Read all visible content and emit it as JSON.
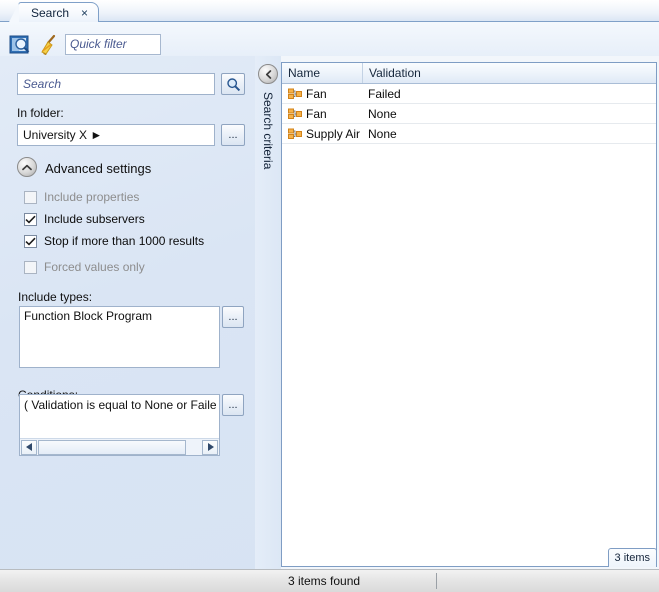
{
  "window": {
    "tab": {
      "label": "Search",
      "close_glyph": "×"
    }
  },
  "toolbar": {
    "search_icon_name": "search-document-icon",
    "clear_icon_name": "broom-clear-filter-icon",
    "quick_filter_placeholder": "Quick filter"
  },
  "criteria": {
    "search_placeholder": "Search",
    "search_button_icon": "magnifier-icon",
    "in_folder_label": "In folder:",
    "in_folder_value": "University X ►",
    "in_folder_browse_label": "...",
    "advanced_settings_label": "Advanced settings",
    "advanced_toggle_icon": "chevron-up-icon",
    "checkboxes": [
      {
        "label": "Include properties",
        "checked": false,
        "enabled": false
      },
      {
        "label": "Include subservers",
        "checked": true,
        "enabled": true
      },
      {
        "label": "Stop if more than 1000 results",
        "checked": true,
        "enabled": true
      },
      {
        "label": "Forced values only",
        "checked": false,
        "enabled": false
      }
    ],
    "include_types_label": "Include types:",
    "include_types_items": [
      "Function Block Program"
    ],
    "include_types_browse_label": "...",
    "conditions_label": "Conditions:",
    "conditions_text": "( Validation is equal to None or Faile",
    "conditions_browse_label": "...",
    "scroll_left_glyph": "◄",
    "scroll_right_glyph": "►"
  },
  "sidebar_strip": {
    "collapse_glyph": "◄",
    "label": "Search criteria"
  },
  "results": {
    "columns": [
      "Name",
      "Validation"
    ],
    "rows": [
      {
        "icon": "function-block-program-icon",
        "name": "Fan",
        "validation": "Failed"
      },
      {
        "icon": "function-block-program-icon",
        "name": "Fan",
        "validation": "None"
      },
      {
        "icon": "function-block-program-icon",
        "name": "Supply Air",
        "validation": "None"
      }
    ],
    "items_tab_label": "3 items"
  },
  "status": {
    "text": "3 items found"
  },
  "colors": {
    "panel_blue": "#dae5f4",
    "border_blue": "#7f9dc4",
    "accent_orange": "#f0a030",
    "placeholder_blue": "#4a5a90"
  }
}
